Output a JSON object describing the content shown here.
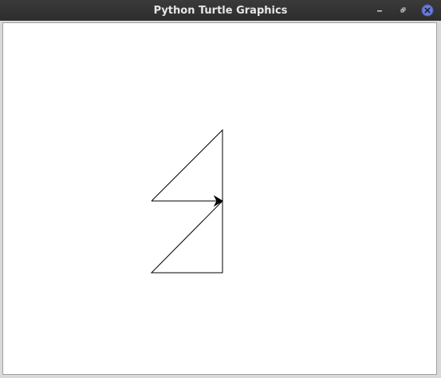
{
  "window": {
    "title": "Python Turtle Graphics",
    "controls": {
      "minimize_icon": "minimize-icon",
      "maximize_icon": "restore-icon",
      "close_icon": "close-icon",
      "close_color": "#6c7cd8"
    }
  },
  "canvas": {
    "background": "#ffffff",
    "pen_color": "#000000",
    "turtle": {
      "shape": "arrow",
      "heading_degrees": 0
    }
  }
}
